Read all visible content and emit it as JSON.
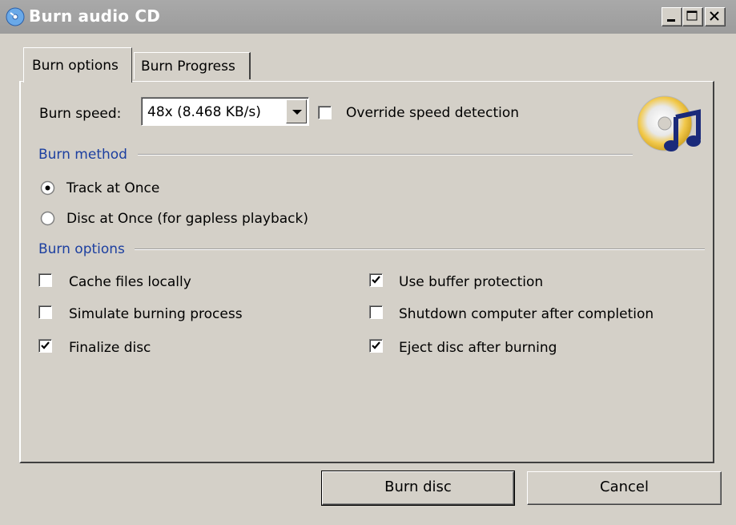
{
  "window": {
    "title": "Burn audio CD",
    "icons": {
      "app": "cd-app-icon",
      "minimize": "minimize-icon",
      "maximize": "maximize-icon",
      "close": "close-icon"
    }
  },
  "tabs": [
    {
      "label": "Burn options",
      "active": true
    },
    {
      "label": "Burn Progress",
      "active": false
    }
  ],
  "burn_speed": {
    "label": "Burn speed:",
    "value": "48x (8.468 KB/s)",
    "override_label": "Override speed detection",
    "override_checked": false
  },
  "burn_method": {
    "title": "Burn method",
    "options": [
      {
        "label": "Track at Once",
        "selected": true
      },
      {
        "label": "Disc at Once (for gapless playback)",
        "selected": false
      }
    ]
  },
  "burn_options": {
    "title": "Burn options",
    "left": [
      {
        "label": "Cache files locally",
        "checked": false
      },
      {
        "label": "Simulate burning process",
        "checked": false
      },
      {
        "label": "Finalize disc",
        "checked": true
      }
    ],
    "right": [
      {
        "label": "Use buffer protection",
        "checked": true
      },
      {
        "label": "Shutdown computer after completion",
        "checked": false
      },
      {
        "label": "Eject disc after burning",
        "checked": true
      }
    ]
  },
  "buttons": {
    "burn": "Burn disc",
    "cancel": "Cancel"
  },
  "colors": {
    "window_bg": "#d4d0c8",
    "titlebar": "#a3a3a3",
    "section_label": "#1c3fa0"
  }
}
